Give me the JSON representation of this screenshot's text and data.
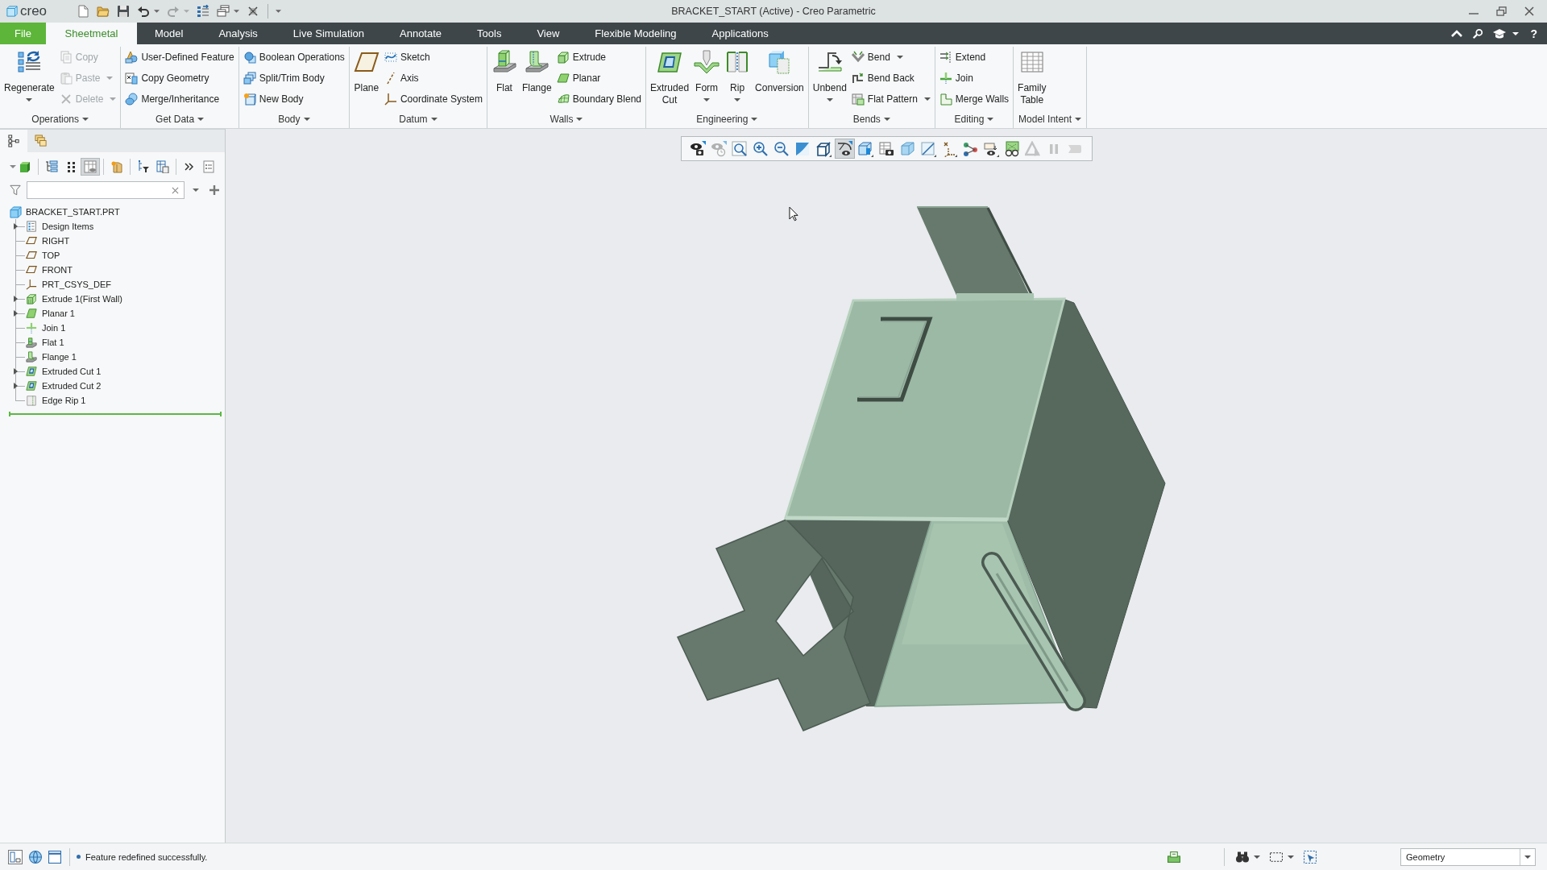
{
  "title_bar": {
    "logo": "creo",
    "title": "BRACKET_START (Active) - Creo Parametric",
    "quick_access": [
      {
        "dropdown": false,
        "disabled": false
      },
      {
        "dropdown": false,
        "disabled": false
      },
      {
        "dropdown": false,
        "disabled": false
      },
      {
        "dropdown": true,
        "disabled": false
      },
      {
        "dropdown": true,
        "disabled": true
      },
      {
        "dropdown": false,
        "disabled": false
      },
      {
        "dropdown": true,
        "disabled": false
      },
      {
        "dropdown": false,
        "disabled": false
      }
    ]
  },
  "menu_tabs": [
    {
      "label": "File",
      "kind": "file",
      "selected": false
    },
    {
      "label": "Sheetmetal",
      "kind": "tab",
      "selected": true
    },
    {
      "label": "Model",
      "kind": "tab",
      "selected": false
    },
    {
      "label": "Analysis",
      "kind": "tab",
      "selected": false
    },
    {
      "label": "Live Simulation",
      "kind": "tab",
      "selected": false
    },
    {
      "label": "Annotate",
      "kind": "tab",
      "selected": false
    },
    {
      "label": "Tools",
      "kind": "tab",
      "selected": false
    },
    {
      "label": "View",
      "kind": "tab",
      "selected": false
    },
    {
      "label": "Flexible Modeling",
      "kind": "tab",
      "selected": false
    },
    {
      "label": "Applications",
      "kind": "tab",
      "selected": false
    }
  ],
  "help": "?",
  "ribbon_groups": [
    {
      "label": "Operations",
      "dropdown": true,
      "items": [
        {
          "kind": "large",
          "label": "Regenerate",
          "dropdown": true,
          "disabled": false
        },
        {
          "kind": "small",
          "label": "Copy",
          "dropdown": false,
          "disabled": true
        },
        {
          "kind": "small",
          "label": "Paste",
          "dropdown": true,
          "disabled": true
        },
        {
          "kind": "small",
          "label": "Delete",
          "dropdown": true,
          "disabled": true
        }
      ]
    },
    {
      "label": "Get Data",
      "dropdown": true,
      "items": [
        {
          "kind": "small",
          "label": "User-Defined Feature",
          "dropdown": false,
          "disabled": false
        },
        {
          "kind": "small",
          "label": "Copy Geometry",
          "dropdown": false,
          "disabled": false
        },
        {
          "kind": "small",
          "label": "Merge/Inheritance",
          "dropdown": false,
          "disabled": false
        }
      ]
    },
    {
      "label": "Body",
      "dropdown": true,
      "items": [
        {
          "kind": "small",
          "label": "Boolean Operations",
          "dropdown": false,
          "disabled": false
        },
        {
          "kind": "small",
          "label": "Split/Trim Body",
          "dropdown": false,
          "disabled": false
        },
        {
          "kind": "small",
          "label": "New Body",
          "dropdown": false,
          "disabled": false
        }
      ]
    },
    {
      "label": "Datum",
      "dropdown": true,
      "items": [
        {
          "kind": "large",
          "label": "Plane",
          "dropdown": false,
          "disabled": false
        },
        {
          "kind": "small",
          "label": "Sketch",
          "dropdown": false,
          "disabled": false
        },
        {
          "kind": "small",
          "label": "Axis",
          "dropdown": false,
          "disabled": false
        },
        {
          "kind": "small",
          "label": "Coordinate System",
          "dropdown": false,
          "disabled": false
        }
      ]
    },
    {
      "label": "Walls",
      "dropdown": true,
      "items": [
        {
          "kind": "large",
          "label": "Flat",
          "dropdown": false,
          "disabled": false
        },
        {
          "kind": "large",
          "label": "Flange",
          "dropdown": false,
          "disabled": false
        },
        {
          "kind": "small",
          "label": "Extrude",
          "dropdown": false,
          "disabled": false
        },
        {
          "kind": "small",
          "label": "Planar",
          "dropdown": false,
          "disabled": false
        },
        {
          "kind": "small",
          "label": "Boundary Blend",
          "dropdown": false,
          "disabled": false
        }
      ]
    },
    {
      "label": "Engineering",
      "dropdown": true,
      "items": [
        {
          "kind": "large",
          "label": "Extruded Cut",
          "dropdown": false,
          "disabled": false
        },
        {
          "kind": "large",
          "label": "Form",
          "dropdown": true,
          "disabled": false
        },
        {
          "kind": "large",
          "label": "Rip",
          "dropdown": true,
          "disabled": false
        },
        {
          "kind": "large",
          "label": "Conversion",
          "dropdown": false,
          "disabled": false
        }
      ]
    },
    {
      "label": "Bends",
      "dropdown": true,
      "items": [
        {
          "kind": "large",
          "label": "Unbend",
          "dropdown": true,
          "disabled": false
        },
        {
          "kind": "small",
          "label": "Bend",
          "dropdown": true,
          "disabled": false
        },
        {
          "kind": "small",
          "label": "Bend Back",
          "dropdown": false,
          "disabled": false
        },
        {
          "kind": "small",
          "label": "Flat Pattern",
          "dropdown": true,
          "disabled": false
        }
      ]
    },
    {
      "label": "Editing",
      "dropdown": true,
      "items": [
        {
          "kind": "small",
          "label": "Extend",
          "dropdown": false,
          "disabled": false
        },
        {
          "kind": "small",
          "label": "Join",
          "dropdown": false,
          "disabled": false
        },
        {
          "kind": "small",
          "label": "Merge Walls",
          "dropdown": false,
          "disabled": false
        }
      ]
    },
    {
      "label": "Model Intent",
      "dropdown": true,
      "items": [
        {
          "kind": "large",
          "label": "Family Table",
          "dropdown": false,
          "disabled": false
        }
      ]
    }
  ],
  "model_tree": {
    "panel_tabs": [
      {
        "selected": true
      },
      {
        "selected": false
      }
    ],
    "toolbar": [
      {
        "dropdown": true,
        "pressed": false
      },
      {
        "dropdown": false,
        "pressed": false
      },
      {
        "dropdown": false,
        "pressed": false
      },
      {
        "dropdown": false,
        "pressed": true
      },
      {
        "dropdown": false,
        "pressed": false
      },
      {
        "dropdown": false,
        "pressed": false
      },
      {
        "dropdown": false,
        "pressed": false
      },
      {
        "dropdown": false,
        "pressed": false
      },
      {
        "dropdown": false,
        "pressed": false
      }
    ],
    "tree": {
      "label": "BRACKET_START.PRT",
      "kind": "part",
      "children": [
        {
          "label": "Design Items",
          "kind": "design_items",
          "expandable": true
        },
        {
          "label": "RIGHT",
          "kind": "plane",
          "expandable": false
        },
        {
          "label": "TOP",
          "kind": "plane",
          "expandable": false
        },
        {
          "label": "FRONT",
          "kind": "plane",
          "expandable": false
        },
        {
          "label": "PRT_CSYS_DEF",
          "kind": "csys",
          "expandable": false
        },
        {
          "label": "Extrude 1(First Wall)",
          "kind": "extrude",
          "expandable": true
        },
        {
          "label": "Planar 1",
          "kind": "planar",
          "expandable": true
        },
        {
          "label": "Join 1",
          "kind": "join",
          "expandable": false
        },
        {
          "label": "Flat 1",
          "kind": "flat",
          "expandable": false
        },
        {
          "label": "Flange 1",
          "kind": "flange",
          "expandable": false
        },
        {
          "label": "Extruded Cut 1",
          "kind": "cut",
          "expandable": true
        },
        {
          "label": "Extruded Cut 2",
          "kind": "cut",
          "expandable": true
        },
        {
          "label": "Edge Rip 1",
          "kind": "rip",
          "expandable": false
        }
      ]
    }
  },
  "view_toolbar": [
    {
      "pressed": false,
      "disabled": false
    },
    {
      "pressed": false,
      "disabled": true
    },
    {
      "pressed": false,
      "disabled": false
    },
    {
      "pressed": false,
      "disabled": false
    },
    {
      "pressed": false,
      "disabled": false
    },
    {
      "pressed": false,
      "disabled": false
    },
    {
      "pressed": false,
      "disabled": false
    },
    {
      "pressed": true,
      "disabled": false
    },
    {
      "pressed": false,
      "disabled": false
    },
    {
      "pressed": false,
      "disabled": false
    },
    {
      "pressed": false,
      "disabled": false
    },
    {
      "pressed": false,
      "disabled": false
    },
    {
      "pressed": false,
      "disabled": false
    },
    {
      "pressed": false,
      "disabled": false
    },
    {
      "pressed": false,
      "disabled": false
    },
    {
      "pressed": false,
      "disabled": false
    },
    {
      "pressed": false,
      "disabled": true
    },
    {
      "pressed": false,
      "disabled": true
    },
    {
      "pressed": false,
      "disabled": true
    }
  ],
  "status_bar": {
    "message": "Feature redefined successfully.",
    "filter": "Geometry"
  }
}
